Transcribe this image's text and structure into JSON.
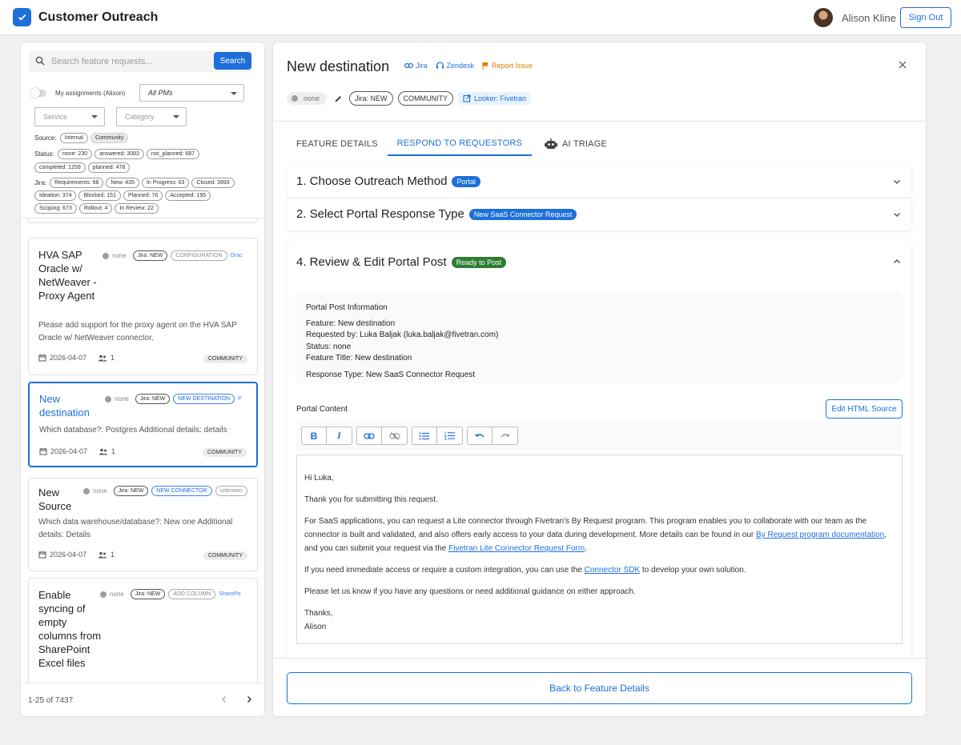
{
  "header": {
    "app_title": "Customer Outreach",
    "user_name": "Alison Kline",
    "sign_out": "Sign Out"
  },
  "sidebar": {
    "search": {
      "placeholder": "Search feature requests...",
      "button": "Search"
    },
    "toggle_label": "My assignments (Alison)",
    "pm_select": "All PMs",
    "service_select": "Service",
    "category_select": "Category",
    "source": {
      "label": "Source:",
      "chips": [
        "Internal",
        "Community"
      ]
    },
    "status": {
      "label": "Status:",
      "chips_row1": [
        "none: 230",
        "answered: 3083",
        "not_planned: 687"
      ],
      "chips_row2": [
        "completed: 1259",
        "planned: 478"
      ]
    },
    "jira": {
      "label": "Jira:",
      "chips_row1": [
        "Requirements: 68",
        "New: 435",
        "In Progress: 63",
        "Closed: 3993"
      ],
      "chips_row2": [
        "Ideation: 374",
        "Blocked: 151",
        "Planned: 76",
        "Accepted: 195"
      ],
      "chips_row3": [
        "Scoping: 673",
        "Rollout: 4",
        "In Review: 22"
      ]
    },
    "cards": [
      {
        "title": "HVA SAP Oracle w/ NetWeaver - Proxy Agent",
        "status": "none",
        "jira": "Jira: NEW",
        "category": "CONFIGURATION",
        "service": "Orac",
        "description": "Please add support for the proxy agent on the HVA SAP Oracle w/ NetWeaver connector.",
        "date": "2026-04-07",
        "count": "1",
        "source": "COMMUNITY"
      },
      {
        "title": "New destination",
        "status": "none",
        "jira": "Jira: NEW",
        "category": "NEW DESTINATION",
        "service": "P",
        "description": "Which database?: Postgres Additional details: details",
        "date": "2026-04-07",
        "count": "1",
        "source": "COMMUNITY"
      },
      {
        "title": "New Source",
        "status": "none",
        "jira": "Jira: NEW",
        "category": "NEW CONNECTOR",
        "service": "unknown",
        "description": "Which data warehouse/database?: New one Additional details: Details",
        "date": "2026-04-07",
        "count": "1",
        "source": "COMMUNITY"
      },
      {
        "title": "Enable syncing of empty columns from SharePoint Excel files",
        "status": "none",
        "jira": "Jira: NEW",
        "category": "ADD COLUMN",
        "service": "SharePo"
      }
    ],
    "pager": {
      "text": "1-25 of 7437"
    }
  },
  "detail": {
    "title": "New destination",
    "links": {
      "jira": "Jira",
      "zendesk": "Zendesk",
      "report": "Report Issue"
    },
    "status": "none",
    "jira_status": "Jira: NEW",
    "source": "COMMUNITY",
    "looker": "Looker: Fivetran",
    "tabs": [
      "FEATURE DETAILS",
      "RESPOND TO REQUESTORS",
      "AI TRIAGE"
    ],
    "step1": {
      "title": "1. Choose Outreach Method",
      "badge": "Portal"
    },
    "step2": {
      "title": "2. Select Portal Response Type",
      "badge": "New SaaS Connector Request"
    },
    "step4": {
      "title": "4. Review & Edit Portal Post",
      "badge": "Ready to Post",
      "info_heading": "Portal Post Information",
      "info_lines": [
        "Feature: New destination",
        "Requested by: Luka Baljak (luka.baljak@fivetran.com)",
        "Status: none",
        "Feature Title: New destination"
      ],
      "response_type": "Response Type: New SaaS Connector Request",
      "portal_label": "Portal Content",
      "edit_html": "Edit HTML Source"
    },
    "editor": {
      "greeting": "Hi Luka,",
      "thanks": "Thank you for submitting this request.",
      "p1_text1": "For SaaS applications, you can request a Lite connector through Fivetran's By Request program. This program enables you to collaborate with our team as the connector is built and validated, and also offers early access to your data during development. More details can be found in our ",
      "p1_link1": "By Request program documentation",
      "p1_text2": ", and you can submit your request via the ",
      "p1_link2": "Fivetran Lite Connector Request Form",
      "p1_text3": ".",
      "p2_text1": "If you need immediate access or require a custom integration, you can use the ",
      "p2_link": "Connector SDK",
      "p2_text2": " to develop your own solution.",
      "p3": "Please let us know if you have any questions or need additional guidance on either approach.",
      "signoff": "Thanks,",
      "signature": "Alison"
    },
    "back_button": "Back to Feature Details"
  },
  "colors": {
    "accent": "#1e6fd9",
    "ready": "#2e7d32",
    "report": "#e07b00"
  }
}
